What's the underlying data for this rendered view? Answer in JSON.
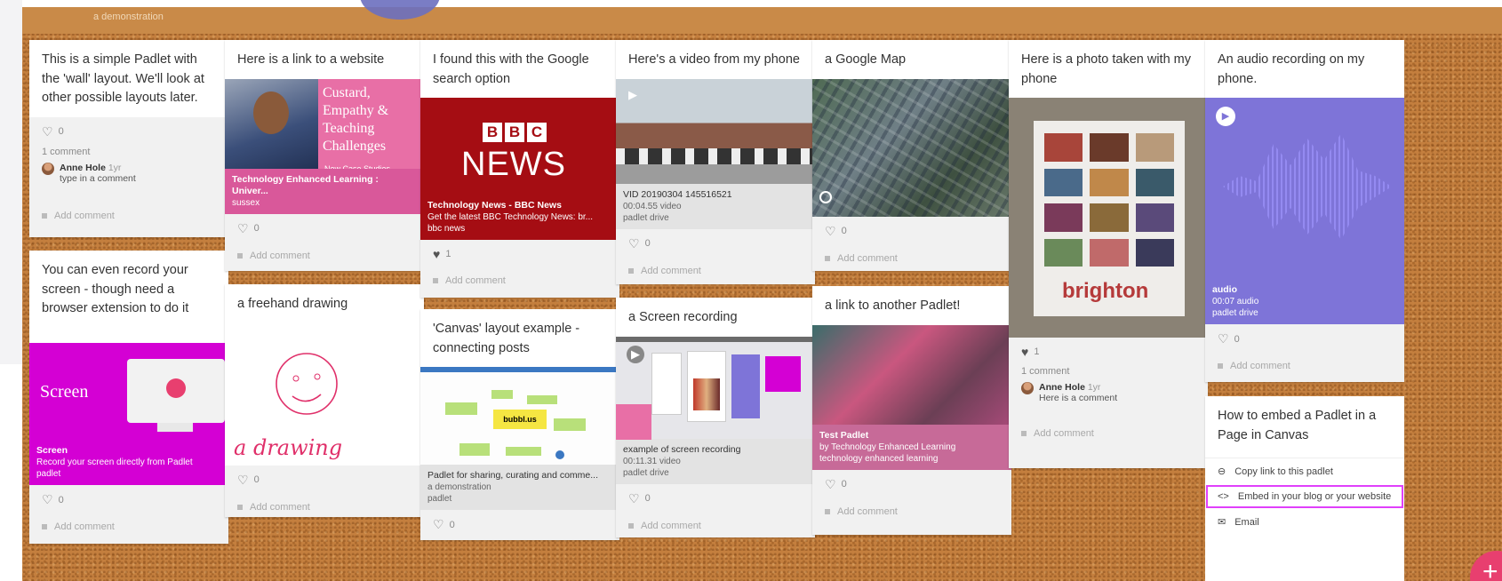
{
  "header": {
    "subtitle": "a demonstration"
  },
  "cards": {
    "c1": {
      "title": "This is a simple Padlet with the 'wall' layout. We'll look at other possible layouts later.",
      "likes": "0",
      "comments_count": "1 comment",
      "comment_author": "Anne Hole",
      "comment_time": "1yr",
      "comment_text": "type in a comment",
      "add_comment": "Add comment"
    },
    "c2": {
      "title": "You can even record your screen - though need a browser extension to do it",
      "media_word": "Screen",
      "cap_title": "Screen",
      "cap_desc": "Record your screen directly from Padlet",
      "cap_src": "padlet",
      "likes": "0",
      "add_comment": "Add comment"
    },
    "c3": {
      "title": "Here is a link to a website",
      "thumb_text": "Custard, Empathy & Teaching Challenges",
      "thumb_sub": "New Case Studies",
      "cap_title": "Technology Enhanced Learning : Univer...",
      "cap_src": "sussex",
      "likes": "0",
      "add_comment": "Add comment"
    },
    "c4": {
      "title": "a freehand drawing",
      "drawing_label": "a drawing",
      "likes": "0",
      "add_comment": "Add comment"
    },
    "c5": {
      "title": "I found this with the Google search option",
      "logo_blocks": "BBC",
      "logo_word": "NEWS",
      "cap_title": "Technology News - BBC News",
      "cap_desc": "Get the latest BBC Technology News: br...",
      "cap_src": "bbc news",
      "likes": "1",
      "add_comment": "Add comment"
    },
    "c6": {
      "title": "'Canvas' layout example - connecting posts",
      "center_node": "bubbl.us",
      "cap_title": "Padlet for sharing, curating and comme...",
      "cap_desc": "a demonstration",
      "cap_src": "padlet",
      "likes": "0"
    },
    "c7": {
      "title": "Here's a video from my phone",
      "cap_title": "VID 20190304 145516521",
      "cap_desc": "00:04.55 video",
      "cap_src": "padlet drive",
      "likes": "0",
      "add_comment": "Add comment"
    },
    "c8": {
      "title": "a Screen recording",
      "cap_title": "example of screen recording",
      "cap_desc": "00:11.31 video",
      "cap_src": "padlet drive",
      "likes": "0",
      "add_comment": "Add comment"
    },
    "c9": {
      "title": "a Google Map",
      "likes": "0",
      "add_comment": "Add comment"
    },
    "c10": {
      "title": "a link to another Padlet!",
      "cap_title": "Test Padlet",
      "cap_desc": "by Technology Enhanced Learning",
      "cap_src": "technology enhanced learning",
      "likes": "0",
      "add_comment": "Add comment"
    },
    "c11": {
      "title": "Here is a photo taken with my phone",
      "poster_word": "brighton",
      "likes": "1",
      "comments_count": "1 comment",
      "comment_author": "Anne Hole",
      "comment_time": "1yr",
      "comment_text": "Here is a comment",
      "add_comment": "Add comment"
    },
    "c12": {
      "title": "An audio recording on my phone.",
      "cap_title": "audio",
      "cap_desc": "00:07 audio",
      "cap_src": "padlet drive",
      "likes": "0",
      "add_comment": "Add comment"
    },
    "c13": {
      "title": "How to embed a Padlet in a Page in Canvas",
      "menu": [
        "Copy link to this padlet",
        "Embed in your blog or your website",
        "Email"
      ]
    }
  },
  "colors": {
    "board": "#c47f3e",
    "accent_pink": "#e83f6f",
    "magenta": "#d400d4",
    "bbc_red": "#a50d13",
    "audio_purple": "#7e74d8",
    "link_pink": "#e86fa6"
  }
}
